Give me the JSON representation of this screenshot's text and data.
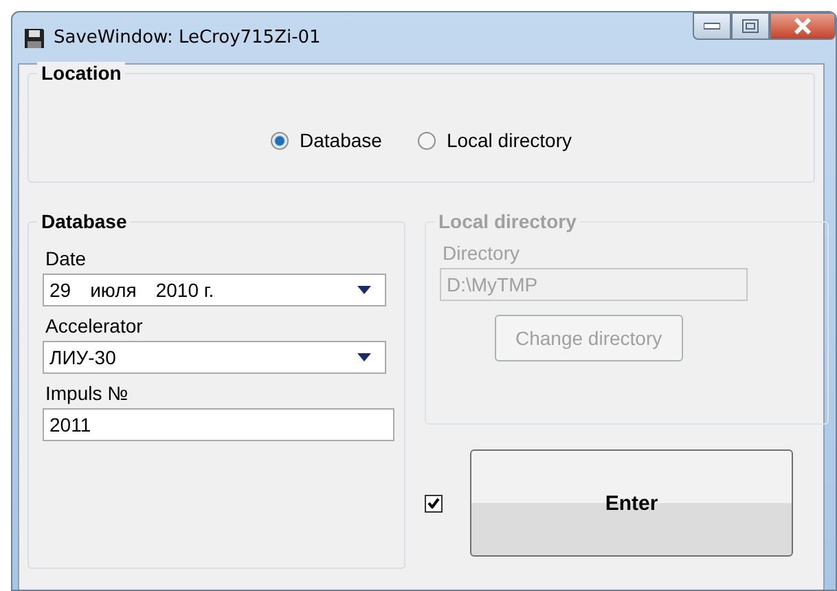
{
  "window": {
    "title": "SaveWindow:  LeCroy715Zi-01"
  },
  "location": {
    "title": "Location",
    "options": [
      {
        "label": "Database",
        "selected": true
      },
      {
        "label": "Local directory",
        "selected": false
      }
    ]
  },
  "database": {
    "title": "Database",
    "date": {
      "label": "Date",
      "parts": [
        "29",
        "июля",
        "2010 г."
      ]
    },
    "accelerator": {
      "label": "Accelerator",
      "value": "ЛИУ-30"
    },
    "impulse": {
      "label": "Impuls №",
      "value": "2011"
    }
  },
  "local_directory": {
    "title": "Local directory",
    "disabled": true,
    "directory": {
      "label": "Directory",
      "value": "D:\\MyTMP"
    },
    "button": "Change directory"
  },
  "enter": {
    "checked": true,
    "button": "Enter"
  }
}
